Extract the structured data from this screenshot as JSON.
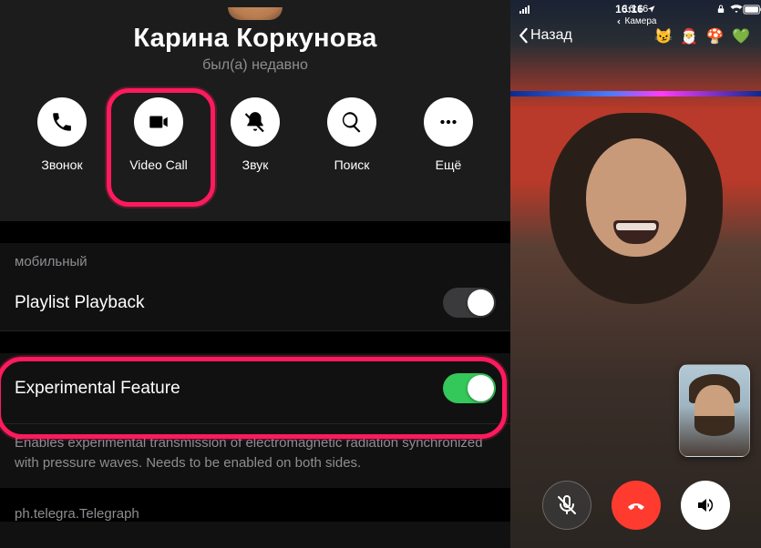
{
  "profile": {
    "name": "Карина Коркунова",
    "status": "был(а) недавно"
  },
  "actions": {
    "call": "Звонок",
    "video": "Video Call",
    "sound": "Звук",
    "search": "Поиск",
    "more": "Ещё"
  },
  "sections": {
    "mobile_label": "мобильный"
  },
  "settings": {
    "playlist": {
      "label": "Playlist Playback",
      "on": false
    },
    "experimental": {
      "label": "Experimental Feature",
      "on": true,
      "description": "Enables experimental transmission of electromagnetic radiation synchronized with pressure waves. Needs to be enabled on both sides."
    }
  },
  "footer_note": "ph.telegra.Telegraph",
  "right": {
    "time": "16:16",
    "camera_label": "Камера",
    "back_label": "Назад",
    "emojis": "😼 🎅 🍄 💚"
  }
}
